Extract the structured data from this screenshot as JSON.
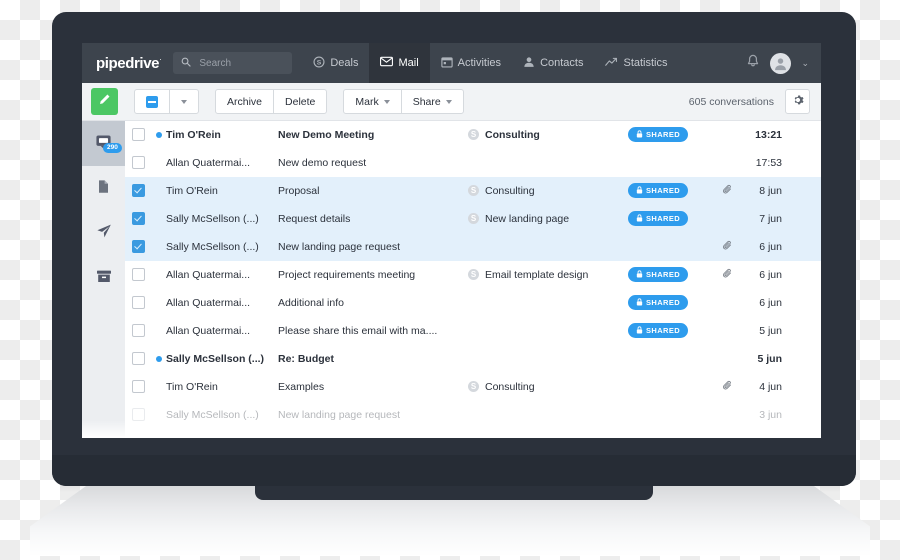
{
  "brand": {
    "logo": "pipedrive",
    "logo_mark": "·",
    "accent_blue": "#2e9ced",
    "accent_green": "#4cc764",
    "nav_bg": "#3d444d"
  },
  "search": {
    "value": "",
    "placeholder": "Search"
  },
  "nav": {
    "items": [
      {
        "label": "Deals",
        "icon": "dollar-circle-icon",
        "active": false
      },
      {
        "label": "Mail",
        "icon": "envelope-icon",
        "active": true
      },
      {
        "label": "Activities",
        "icon": "calendar-icon",
        "active": false
      },
      {
        "label": "Contacts",
        "icon": "person-icon",
        "active": false
      },
      {
        "label": "Statistics",
        "icon": "trend-arrow-icon",
        "active": false
      }
    ],
    "bell_icon": "bell-icon",
    "avatar_icon": "avatar-icon",
    "chevron": "⌄"
  },
  "toolbar": {
    "compose_icon": "pencil-icon",
    "select_all_state": "indeterminate",
    "archive_label": "Archive",
    "delete_label": "Delete",
    "mark_label": "Mark",
    "share_label": "Share",
    "conversations_count": "605 conversations",
    "gear_icon": "gear-icon"
  },
  "sidebar": {
    "items": [
      {
        "icon": "inbox-icon",
        "badge": "290",
        "active": true
      },
      {
        "icon": "drafts-document-icon",
        "badge": "",
        "active": false
      },
      {
        "icon": "sent-paper-plane-icon",
        "badge": "",
        "active": false
      },
      {
        "icon": "archive-box-icon",
        "badge": "",
        "active": false
      }
    ]
  },
  "list": {
    "rows": [
      {
        "checked": false,
        "unread": true,
        "from": "Tim O'Rein",
        "subject": "New Demo Meeting",
        "deal": "Consulting",
        "shared": "SHARED",
        "attachment": false,
        "time": "13:21",
        "faded": false
      },
      {
        "checked": false,
        "unread": false,
        "from": "Allan Quatermai...",
        "subject": "New demo request",
        "deal": "",
        "shared": "",
        "attachment": false,
        "time": "17:53",
        "faded": false
      },
      {
        "checked": true,
        "unread": false,
        "from": "Tim O'Rein",
        "subject": "Proposal",
        "deal": "Consulting",
        "shared": "SHARED",
        "attachment": true,
        "time": "8 jun",
        "faded": false
      },
      {
        "checked": true,
        "unread": false,
        "from": "Sally McSellson (...)",
        "subject": "Request details",
        "deal": "New landing page",
        "shared": "SHARED",
        "attachment": false,
        "time": "7 jun",
        "faded": false
      },
      {
        "checked": true,
        "unread": false,
        "from": "Sally McSellson (...)",
        "subject": "New landing page request",
        "deal": "",
        "shared": "",
        "attachment": true,
        "time": "6 jun",
        "faded": false
      },
      {
        "checked": false,
        "unread": false,
        "from": "Allan Quatermai...",
        "subject": "Project requirements meeting",
        "deal": "Email template design",
        "shared": "SHARED",
        "attachment": true,
        "time": "6 jun",
        "faded": false
      },
      {
        "checked": false,
        "unread": false,
        "from": "Allan Quatermai...",
        "subject": "Additional info",
        "deal": "",
        "shared": "SHARED",
        "attachment": false,
        "time": "6 jun",
        "faded": false
      },
      {
        "checked": false,
        "unread": false,
        "from": "Allan Quatermai...",
        "subject": "Please share this email with ma....",
        "deal": "",
        "shared": "SHARED",
        "attachment": false,
        "time": "5 jun",
        "faded": false
      },
      {
        "checked": false,
        "unread": true,
        "from": "Sally McSellson (...)",
        "subject": "Re: Budget",
        "deal": "",
        "shared": "",
        "attachment": false,
        "time": "5 jun",
        "faded": false
      },
      {
        "checked": false,
        "unread": false,
        "from": "Tim O'Rein",
        "subject": "Examples",
        "deal": "Consulting",
        "shared": "",
        "attachment": true,
        "time": "4 jun",
        "faded": false
      },
      {
        "checked": false,
        "unread": false,
        "from": "Sally McSellson (...)",
        "subject": "New landing page request",
        "deal": "",
        "shared": "",
        "attachment": false,
        "time": "3 jun",
        "faded": true
      }
    ]
  }
}
